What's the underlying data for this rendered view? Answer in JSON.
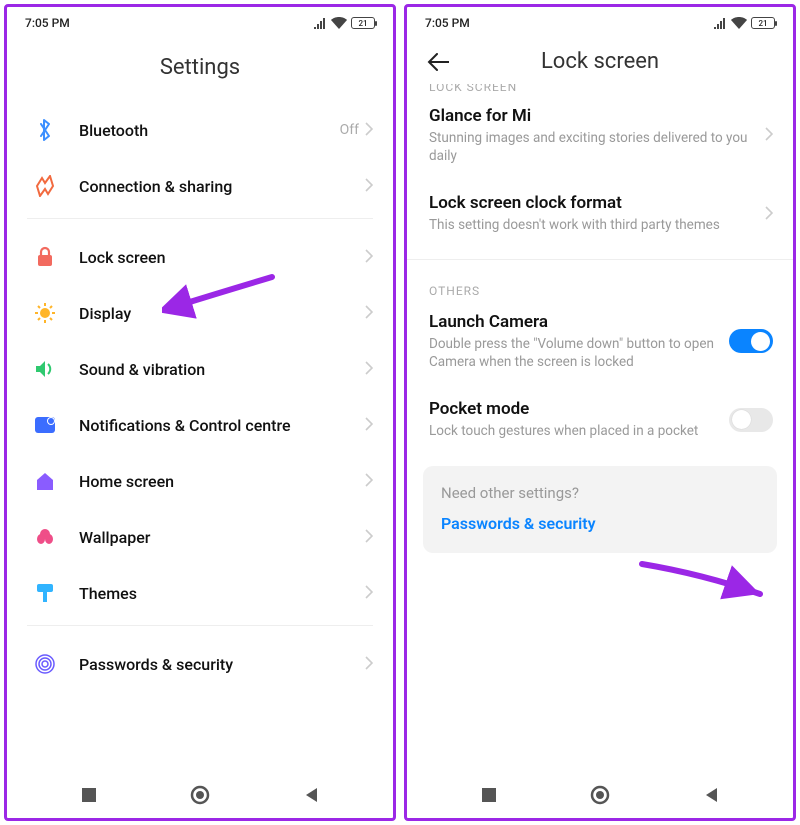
{
  "status": {
    "time": "7:05 PM",
    "battery_pct": "21"
  },
  "left": {
    "title": "Settings",
    "items": [
      {
        "icon": "bluetooth-icon",
        "label": "Bluetooth",
        "value": "Off"
      },
      {
        "icon": "share-icon",
        "label": "Connection & sharing"
      }
    ],
    "items2": [
      {
        "icon": "lock-icon",
        "label": "Lock screen",
        "highlight": true
      },
      {
        "icon": "sun-icon",
        "label": "Display"
      },
      {
        "icon": "speaker-icon",
        "label": "Sound & vibration"
      },
      {
        "icon": "bell-icon",
        "label": "Notifications & Control centre"
      },
      {
        "icon": "home-icon",
        "label": "Home screen"
      },
      {
        "icon": "flower-icon",
        "label": "Wallpaper"
      },
      {
        "icon": "brush-icon",
        "label": "Themes"
      }
    ],
    "items3": [
      {
        "icon": "fingerprint-icon",
        "label": "Passwords & security"
      }
    ]
  },
  "right": {
    "title": "Lock screen",
    "group1_header": "LOCK SCREEN",
    "group1": [
      {
        "title": "Glance for Mi",
        "desc": "Stunning images and exciting stories delivered to you daily",
        "type": "chevron"
      },
      {
        "title": "Lock screen clock format",
        "desc": "This setting doesn't work with third party themes",
        "type": "chevron"
      }
    ],
    "group2_header": "OTHERS",
    "group2": [
      {
        "title": "Launch Camera",
        "desc": "Double press the \"Volume down\" button to open Camera when the screen is locked",
        "type": "toggle",
        "on": true
      },
      {
        "title": "Pocket mode",
        "desc": "Lock touch gestures when placed in a pocket",
        "type": "toggle",
        "on": false,
        "highlight": true
      }
    ],
    "footer": {
      "question": "Need other settings?",
      "link": "Passwords & security"
    }
  },
  "annotations": {
    "arrow_color": "#9b27e6"
  }
}
